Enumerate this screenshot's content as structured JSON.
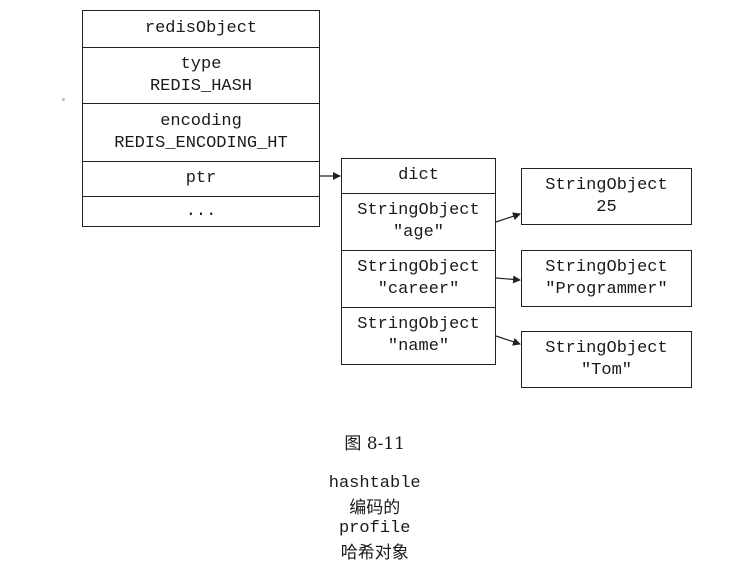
{
  "redis_object": {
    "header": "redisObject",
    "type_label": "type",
    "type_value": "REDIS_HASH",
    "encoding_label": "encoding",
    "encoding_value": "REDIS_ENCODING_HT",
    "ptr": "ptr",
    "more": "..."
  },
  "dict": {
    "header": "dict",
    "keys": [
      {
        "line1": "StringObject",
        "line2": "\"age\""
      },
      {
        "line1": "StringObject",
        "line2": "\"career\""
      },
      {
        "line1": "StringObject",
        "line2": "\"name\""
      }
    ]
  },
  "values": [
    {
      "line1": "StringObject",
      "line2": "25"
    },
    {
      "line1": "StringObject",
      "line2": "\"Programmer\""
    },
    {
      "line1": "StringObject",
      "line2": "\"Tom\""
    }
  ],
  "caption": {
    "figure": "图 8-11",
    "word1": "hashtable",
    "text1": "编码的",
    "word2": "profile",
    "text2": "哈希对象"
  }
}
